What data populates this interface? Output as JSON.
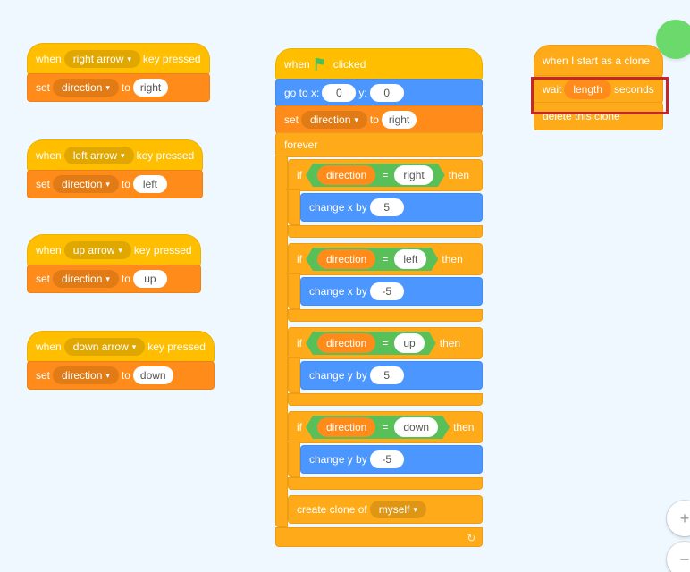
{
  "colors": {
    "events": "#ffbf00",
    "control": "#ffab19",
    "data": "#ff8c1a",
    "motion": "#4c97ff",
    "operator": "#59c059"
  },
  "txt": {
    "when": "when",
    "key_pressed": "key pressed",
    "set": "set",
    "to": "to",
    "direction": "direction",
    "right": "right",
    "left": "left",
    "up": "up",
    "down": "down",
    "right_arrow": "right arrow",
    "left_arrow": "left arrow",
    "up_arrow": "up arrow",
    "down_arrow": "down arrow",
    "clicked": "clicked",
    "goto": "go to x:",
    "y": "y:",
    "x0": "0",
    "y0": "0",
    "forever": "forever",
    "if": "if",
    "then": "then",
    "eq": "=",
    "change_x": "change x by",
    "change_y": "change y by",
    "five": "5",
    "neg5": "-5",
    "create_clone": "create clone of",
    "myself": "myself",
    "start_clone": "when I start as a clone",
    "wait": "wait",
    "seconds": "seconds",
    "length": "length",
    "delete_clone": "delete this clone"
  }
}
